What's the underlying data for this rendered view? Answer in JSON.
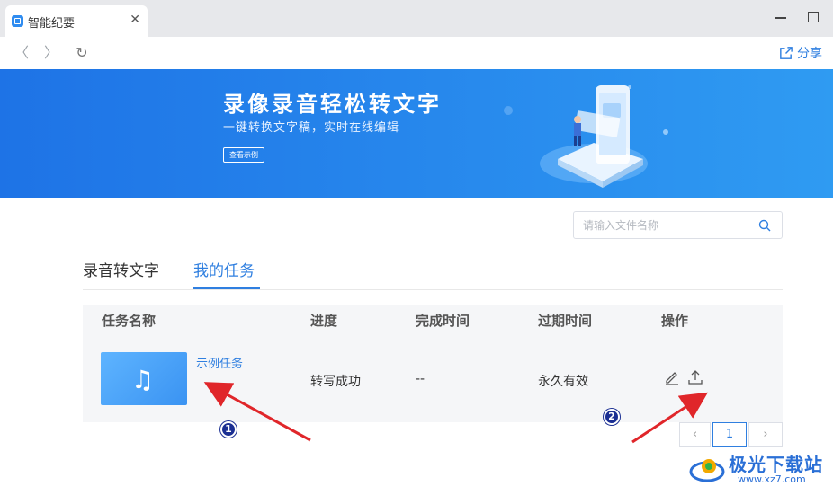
{
  "window": {
    "tab_title": "智能纪要",
    "close_glyph": "✕"
  },
  "toolbar": {
    "back_glyph": "〈",
    "forward_glyph": "〉",
    "reload_glyph": "↻",
    "share_label": "分享"
  },
  "banner": {
    "title": "录像录音轻松转文字",
    "subtitle": "一键转换文字稿，实时在线编辑",
    "button_label": "查看示例"
  },
  "search": {
    "placeholder": "请输入文件名称",
    "value": ""
  },
  "tabs": [
    {
      "label": "录音转文字",
      "active": false
    },
    {
      "label": "我的任务",
      "active": true
    }
  ],
  "table": {
    "columns": [
      "任务名称",
      "进度",
      "完成时间",
      "过期时间",
      "操作"
    ],
    "rows": [
      {
        "name": "示例任务",
        "progress": "转写成功",
        "finish_time": "--",
        "expire_time": "永久有效",
        "actions": [
          "edit-icon",
          "upload-icon"
        ]
      }
    ]
  },
  "pagination": {
    "prev_glyph": "‹",
    "current_page": "1",
    "next_glyph": "›"
  },
  "annotations": {
    "marker_1": "1",
    "marker_2": "2"
  },
  "watermark": {
    "text": "极光下载站",
    "url": "www.xz7.com"
  },
  "colors": {
    "accent": "#2f7fe0",
    "banner_start": "#1e73e6",
    "banner_end": "#2f9bf2",
    "arrow": "#e0262a",
    "marker": "#1b2f93"
  }
}
